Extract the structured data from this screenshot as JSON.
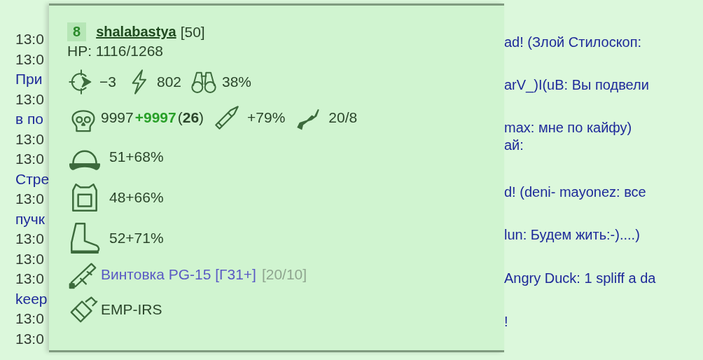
{
  "chat_left": [
    {
      "text": "13:0",
      "kind": "time"
    },
    {
      "text": "13:0",
      "kind": "time"
    },
    {
      "text": "При",
      "kind": "message"
    },
    {
      "text": "13:0",
      "kind": "time"
    },
    {
      "text": "в по",
      "kind": "message"
    },
    {
      "text": "13:0",
      "kind": "time"
    },
    {
      "text": "13:0",
      "kind": "time"
    },
    {
      "text": "Стре",
      "kind": "message"
    },
    {
      "text": "13:0",
      "kind": "time"
    },
    {
      "text": "пучк",
      "kind": "message"
    },
    {
      "text": "13:0",
      "kind": "time"
    },
    {
      "text": "13:0",
      "kind": "time"
    },
    {
      "text": "13:0",
      "kind": "time"
    },
    {
      "text": "keep",
      "kind": "message"
    },
    {
      "text": "13:0",
      "kind": "time"
    },
    {
      "text": "13:0",
      "kind": "time"
    }
  ],
  "chat_right": [
    "ad! (Злой Стилоскоп:",
    "arV_)I(uB: Вы подвели",
    "max: мне по кайфу)",
    "ай:",
    "d! (deni- mayonez: все",
    "lun: Будем жить:-)....)",
    "Angry Duck: 1 spliff a da",
    "!"
  ],
  "player": {
    "level": "8",
    "name": "shalabastya",
    "rank": "[50]",
    "hp": "HP: 1116/1268"
  },
  "stats": [
    {
      "value": "−3"
    },
    {
      "value": "802"
    },
    {
      "value": "38%"
    }
  ],
  "kills": {
    "base": "9997",
    "bonus": "+9997",
    "count": "(**26**)"
  },
  "weapon_stats": [
    {
      "value": "+79%"
    },
    {
      "value": "20/8"
    }
  ],
  "armor": [
    {
      "value": "51+68%"
    },
    {
      "value": "48+66%"
    },
    {
      "value": "52+71%"
    }
  ],
  "items": [
    {
      "name": "Винтовка PG-15 [Г31+]",
      "ammo": "[20/10]",
      "kind": "weapon"
    },
    {
      "name": "EMP-IRS",
      "kind": "plain"
    }
  ]
}
